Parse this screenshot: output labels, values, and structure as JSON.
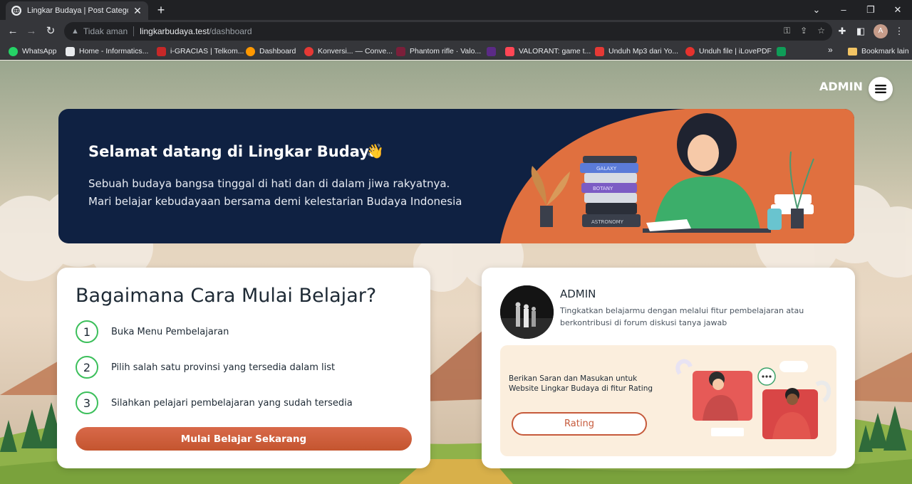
{
  "browser": {
    "tab": {
      "title": "Lingkar Budaya | Post Categories",
      "close": "✕"
    },
    "new_tab": "+",
    "window_controls": {
      "dropdown": "⌄",
      "minimize": "–",
      "maximize": "❐",
      "close": "✕"
    },
    "nav": {
      "back": "←",
      "forward": "→",
      "reload": "↻"
    },
    "address": {
      "warning": "▲",
      "insecure_label": "Tidak aman",
      "host": "lingkarbudaya.test",
      "path": "/dashboard"
    },
    "omnibox_icons": [
      "key-icon",
      "share-icon",
      "star-icon"
    ],
    "toolbar_icons": [
      "extensions-icon",
      "sidepanel-icon"
    ],
    "profile_initial": "A",
    "menu": "⋮",
    "bookmarks": [
      {
        "label": "WhatsApp",
        "color": "#25d366"
      },
      {
        "label": "Home - Informatics...",
        "color": "#e8eaed"
      },
      {
        "label": "i-GRACIAS | Telkom...",
        "color": "#c62828"
      },
      {
        "label": "Dashboard",
        "color": "#ff9800"
      },
      {
        "label": "Konversi... — Conve...",
        "color": "#e53935"
      },
      {
        "label": "Phantom rifle · Valo...",
        "color": "#7b1f3a"
      },
      {
        "label": "",
        "color": "#5b2a86"
      },
      {
        "label": "VALORANT: game t...",
        "color": "#ff4655"
      },
      {
        "label": "Unduh Mp3 dari Yo...",
        "color": "#e53935"
      },
      {
        "label": "Unduh file | iLovePDF",
        "color": "#e5322d"
      },
      {
        "label": "",
        "color": "#0f9d58"
      }
    ],
    "bookmarks_more": "»",
    "bookmarks_other": "Bookmark lain"
  },
  "header": {
    "admin_label": "ADMIN"
  },
  "hero": {
    "title": "Selamat datang di Lingkar Budaya",
    "emoji": "👋",
    "line1": "Sebuah budaya bangsa tinggal di hati dan di dalam jiwa rakyatnya.",
    "line2": "Mari belajar kebudayaan bersama demi kelestarian Budaya Indonesia",
    "book_labels": [
      "GALAXY",
      "BOTANY",
      "ASTRONOMY"
    ]
  },
  "how_to": {
    "title": "Bagaimana Cara Mulai Belajar?",
    "steps": [
      {
        "num": "1",
        "text": "Buka Menu Pembelajaran"
      },
      {
        "num": "2",
        "text": "Pilih salah satu provinsi yang tersedia dalam list"
      },
      {
        "num": "3",
        "text": "Silahkan pelajari pembelajaran yang sudah tersedia"
      }
    ],
    "cta": "Mulai Belajar Sekarang"
  },
  "profile_card": {
    "name": "ADMIN",
    "desc_line1": "Tingkatkan belajarmu dengan melalui fitur pembelajaran atau",
    "desc_line2": "berkontribusi di forum diskusi tanya jawab",
    "rating_line1": "Berikan Saran dan Masukan untuk",
    "rating_line2": "Website Lingkar Budaya di fitur Rating",
    "rating_button": "Rating"
  },
  "colors": {
    "hero_bg": "#0f2142",
    "accent_orange": "#d8694a",
    "step_ring": "#3cbf5b",
    "rating_bg": "#fbeedd"
  }
}
